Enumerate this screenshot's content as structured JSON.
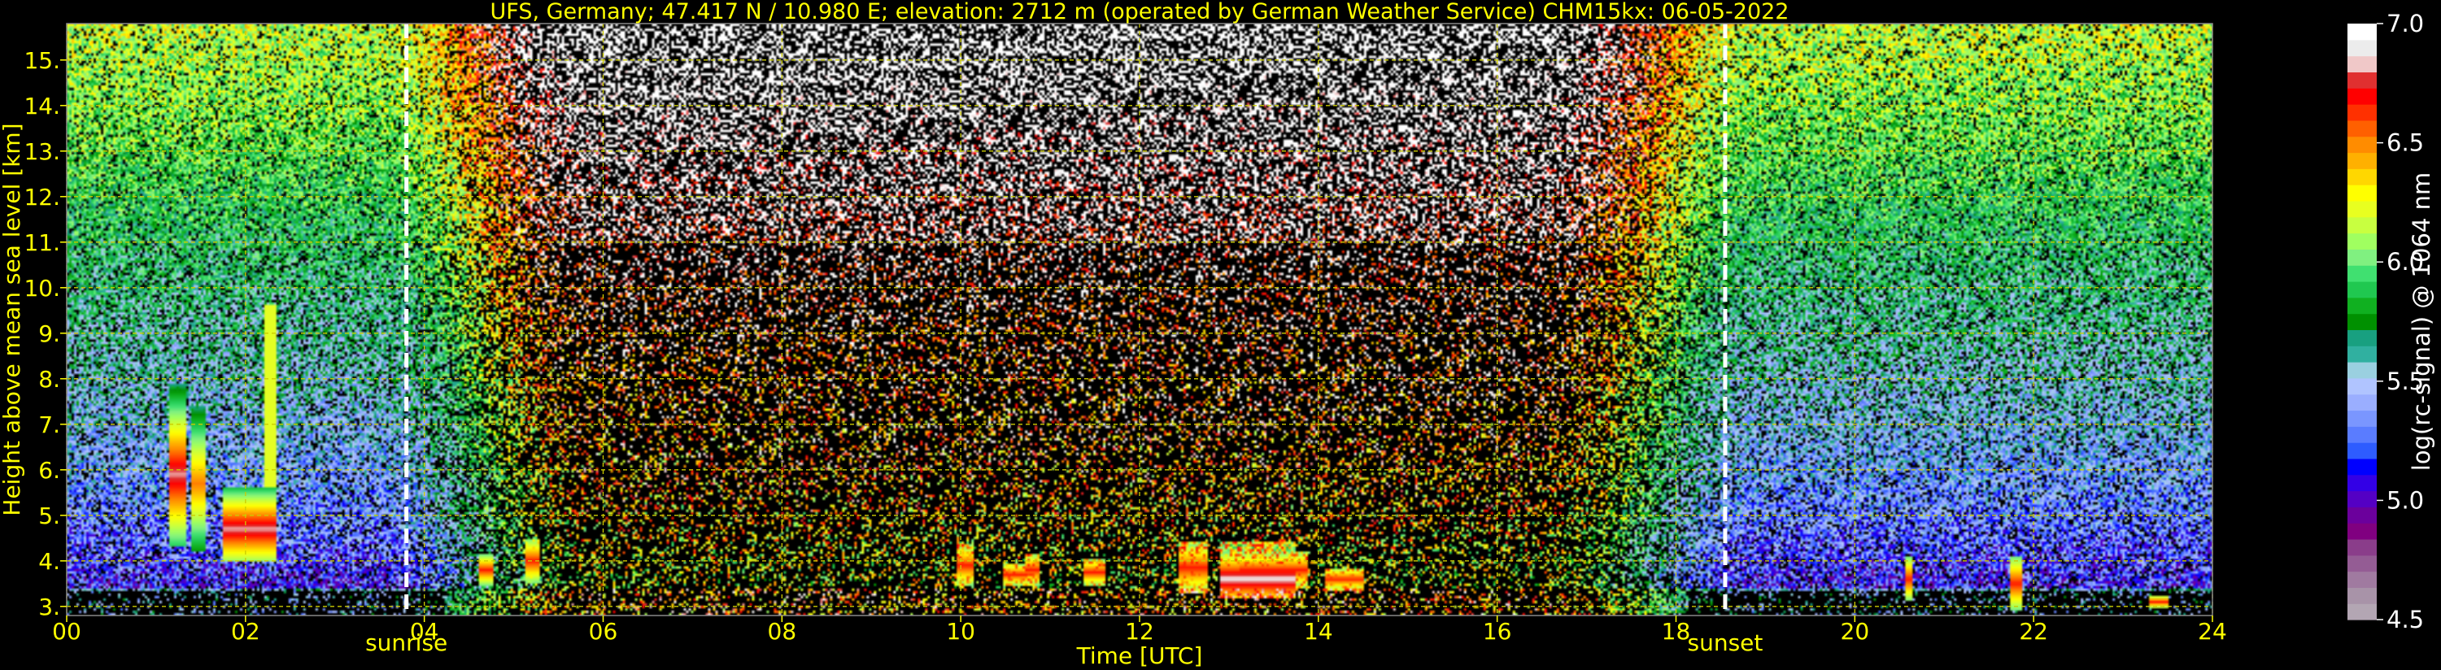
{
  "chart_data": {
    "type": "heatmap",
    "title": "UFS, Germany; 47.417 N / 10.980 E; elevation: 2712 m  (operated by German Weather Service)    CHM15kx: 06-05-2022",
    "xlabel": "Time [UTC]",
    "ylabel": "Height above mean sea level [km]",
    "xlim": [
      0,
      24
    ],
    "ylim": [
      2.8,
      15.8
    ],
    "x_ticks": [
      0,
      2,
      4,
      6,
      8,
      10,
      12,
      14,
      16,
      18,
      20,
      22,
      24
    ],
    "x_tick_labels": [
      "00",
      "02",
      "04",
      "06",
      "08",
      "10",
      "12",
      "14",
      "16",
      "18",
      "20",
      "22",
      "24"
    ],
    "y_ticks": [
      3,
      4,
      5,
      6,
      7,
      8,
      9,
      10,
      11,
      12,
      13,
      14,
      15
    ],
    "y_tick_labels": [
      "3.",
      "4.",
      "5.",
      "6.",
      "7.",
      "8.",
      "9.",
      "10.",
      "11.",
      "12.",
      "13.",
      "14.",
      "15."
    ],
    "grid": true,
    "markers": [
      {
        "label": "sunrise",
        "x": 3.8
      },
      {
        "label": "sunset",
        "x": 18.55
      }
    ],
    "colorbar": {
      "label": "log(rc-signal) @ 1064 nm",
      "range": [
        4.5,
        7.0
      ],
      "ticks": [
        4.5,
        5.0,
        5.5,
        6.0,
        6.5,
        7.0
      ],
      "tick_labels": [
        "4.5",
        "5.0",
        "5.5",
        "6.0",
        "6.5",
        "7.0"
      ],
      "colors": [
        "#b3a6b3",
        "#a893a8",
        "#a07aa0",
        "#945c94",
        "#8a3d8a",
        "#800080",
        "#6b009c",
        "#5400c4",
        "#3300e6",
        "#0000ff",
        "#2e5cff",
        "#5a7cff",
        "#7a96ff",
        "#9aaeff",
        "#b0c4ff",
        "#9ad0e0",
        "#30b0a0",
        "#18a080",
        "#009000",
        "#10b020",
        "#20c850",
        "#40e070",
        "#80f080",
        "#a0ff60",
        "#c8ff40",
        "#e8ff20",
        "#ffff00",
        "#ffd700",
        "#ffb000",
        "#ff8c00",
        "#ff6000",
        "#ff3000",
        "#ff0000",
        "#e03030",
        "#f0c8c8",
        "#ececec",
        "#ffffff"
      ]
    }
  },
  "colors": {
    "text": "#ffff00",
    "grid": "#cccc00",
    "marker": "#ffffff",
    "background": "#000000"
  }
}
